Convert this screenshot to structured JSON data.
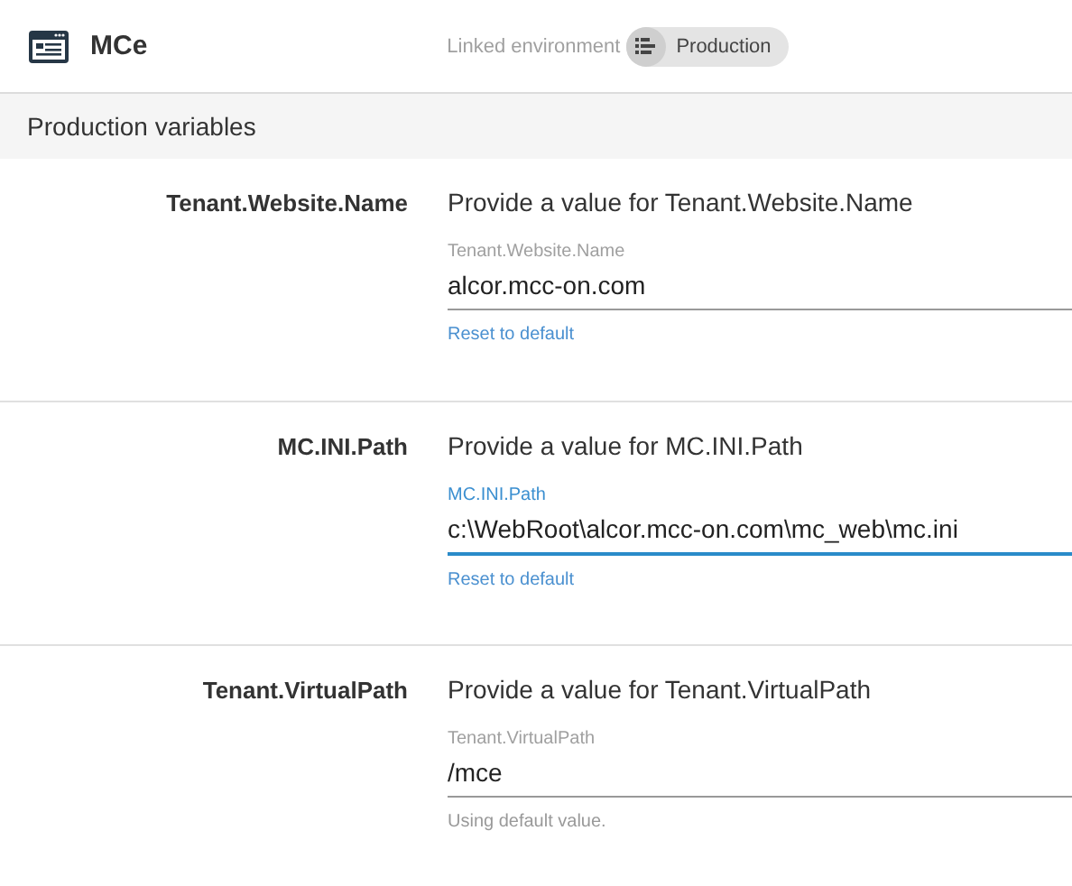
{
  "app": {
    "title": "MCe"
  },
  "linked": {
    "label": "Linked environment",
    "environment": "Production"
  },
  "section": {
    "title": "Production variables"
  },
  "variables": [
    {
      "name": "Tenant.Website.Name",
      "prompt": "Provide a value for Tenant.Website.Name",
      "field_label": "Tenant.Website.Name",
      "value": "alcor.mcc-on.com",
      "focused": false,
      "helper": {
        "kind": "link",
        "text": "Reset to default"
      }
    },
    {
      "name": "MC.INI.Path",
      "prompt": "Provide a value for MC.INI.Path",
      "field_label": "MC.INI.Path",
      "value": "c:\\WebRoot\\alcor.mcc-on.com\\mc_web\\mc.ini",
      "focused": true,
      "helper": {
        "kind": "link",
        "text": "Reset to default"
      }
    },
    {
      "name": "Tenant.VirtualPath",
      "prompt": "Provide a value for Tenant.VirtualPath",
      "field_label": "Tenant.VirtualPath",
      "value": "/mce",
      "focused": false,
      "helper": {
        "kind": "text",
        "text": "Using default value."
      }
    }
  ]
}
